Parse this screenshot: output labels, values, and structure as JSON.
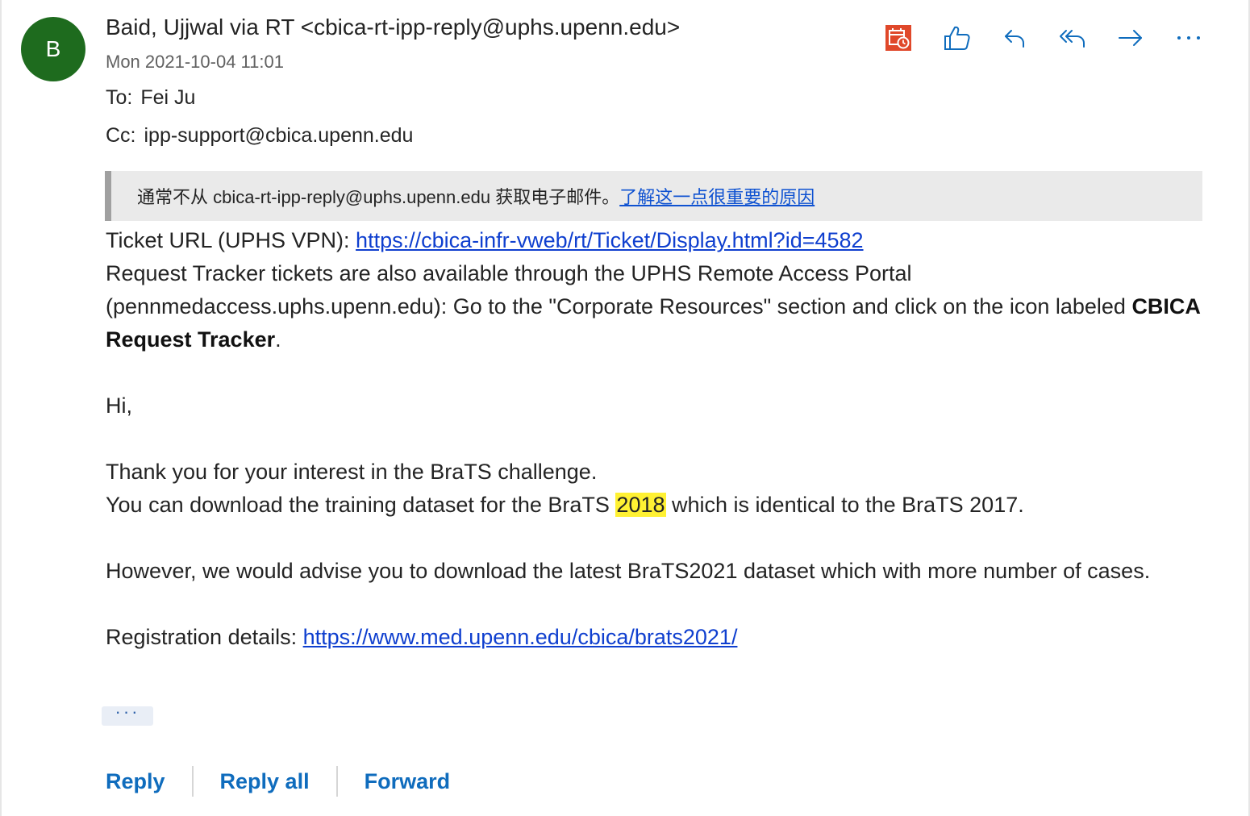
{
  "message": {
    "avatar_initial": "B",
    "avatar_color": "#1e6b1e",
    "sender": "Baid, Ujjwal via RT <cbica-rt-ipp-reply@uphs.upenn.edu>",
    "date": "Mon 2021-10-04 11:01",
    "to_label": "To:",
    "to_value": "Fei Ju",
    "cc_label": "Cc:",
    "cc_value": "ipp-support@cbica.upenn.edu"
  },
  "toolbar": {
    "icons": [
      "calendar-clock-icon",
      "thumbs-up-icon",
      "reply-icon",
      "reply-all-icon",
      "forward-icon",
      "more-icon"
    ]
  },
  "banner": {
    "text": "通常不从 cbica-rt-ipp-reply@uphs.upenn.edu 获取电子邮件。",
    "link": "了解这一点很重要的原因"
  },
  "body": {
    "ticket_label": "Ticket URL (UPHS VPN): ",
    "ticket_url": "https://cbica-infr-vweb/rt/Ticket/Display.html?id=4582",
    "portal_text": "Request Tracker tickets are also available through the UPHS Remote Access Portal (pennmedaccess.uphs.upenn.edu): Go to the \"Corporate Resources\" section and click on the icon labeled ",
    "portal_bold": "CBICA Request Tracker",
    "portal_end": ".",
    "greeting": "Hi,",
    "line1": "Thank you for your interest in the BraTS challenge.",
    "line2_pre": "You can download the training dataset for the BraTS ",
    "line2_highlight": "2018",
    "line2_post": " which is identical to the BraTS 2017.",
    "line3": "However, we would advise you to download the latest BraTS2021 dataset which with more number of cases.",
    "registration_label": "Registration details: ",
    "registration_url": "https://www.med.upenn.edu/cbica/brats2021/"
  },
  "more_label": "···",
  "actions": {
    "reply": "Reply",
    "reply_all": "Reply all",
    "forward": "Forward"
  }
}
